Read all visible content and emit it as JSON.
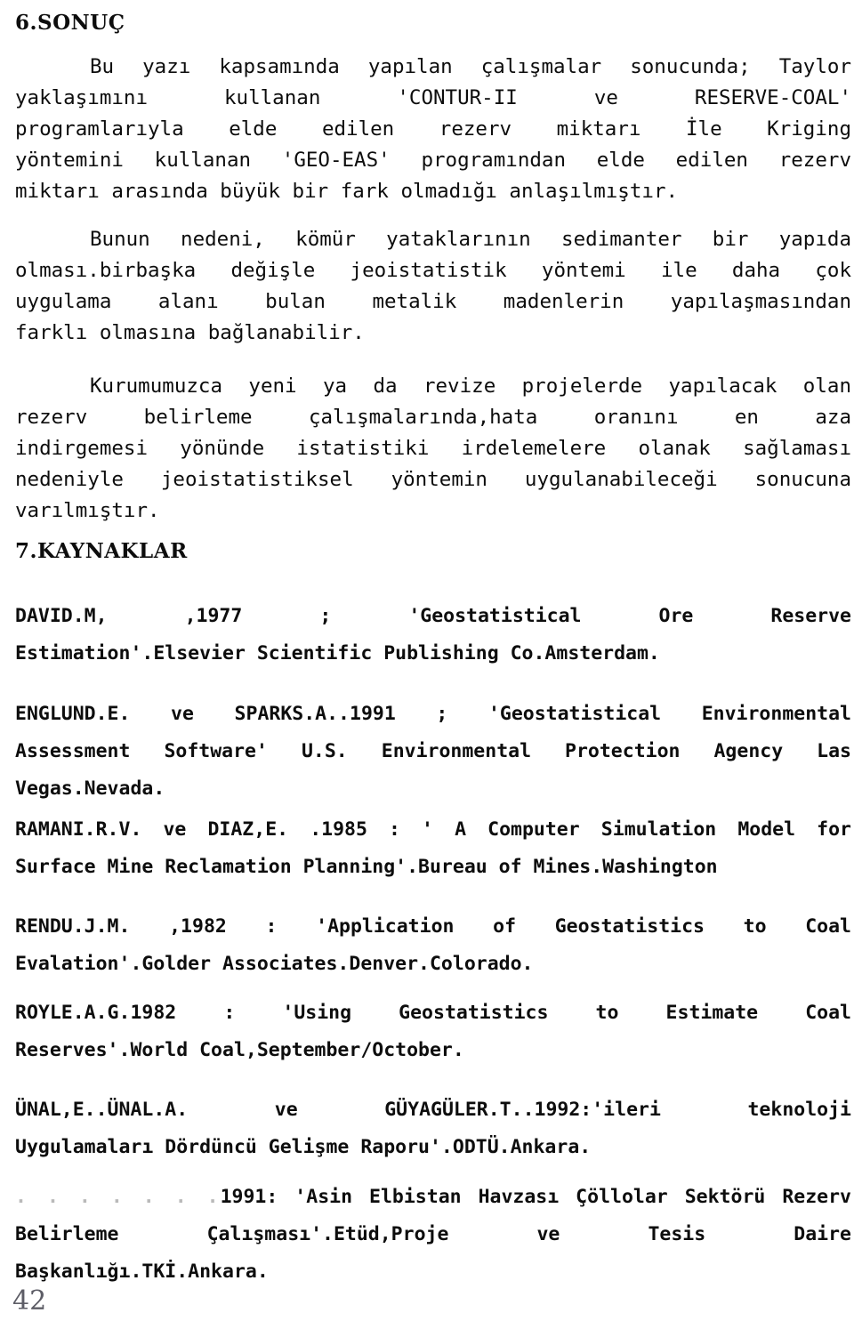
{
  "document": {
    "page_number": "42",
    "language": "tr"
  },
  "sections": {
    "conclusion": {
      "heading": "6.SONUÇ",
      "paragraphs": [
        {
          "id": "p1",
          "lines": [
            "Bu yazı kapsamında yapılan çalışmalar sonucunda; Taylor",
            "yaklaşımını kullanan 'CONTUR-II ve RESERVE-COAL'",
            "programlarıyla elde edilen rezerv miktarı İle Kriging",
            "yöntemini kullanan 'GEO-EAS' programından elde edilen rezerv",
            "miktarı arasında büyük bir fark olmadığı anlaşılmıştır."
          ]
        },
        {
          "id": "p2",
          "lines": [
            "Bunun nedeni, kömür yataklarının sedimanter bir yapıda",
            "olması.birbaşka değişle jeoistatistik yöntemi ile daha çok",
            "uygulama alanı bulan metalik madenlerin yapılaşmasından",
            "farklı olmasına bağlanabilir."
          ]
        },
        {
          "id": "p3",
          "lines": [
            "Kurumumuzca yeni ya da revize projelerde yapılacak olan",
            "rezerv belirleme çalışmalarında,hata oranını en aza",
            "indirgemesi yönünde istatistiki irdelemelere olanak sağlaması",
            "nedeniyle jeoistatistiksel yöntemin uygulanabileceği sonucuna",
            "varılmıştır."
          ]
        }
      ]
    },
    "references": {
      "heading": "7.KAYNAKLAR",
      "entries": [
        {
          "id": "ref-david-1977",
          "lines": [
            "DAVID.M, ,1977 ; 'Geostatistical Ore Reserve",
            "Estimation'.Elsevier Scientific Publishing Co.Amsterdam."
          ]
        },
        {
          "id": "ref-englund-sparks-1991",
          "lines": [
            "ENGLUND.E. ve SPARKS.A..1991 ; 'Geostatistical Environmental",
            "Assessment Software' U.S. Environmental Protection Agency Las",
            "Vegas.Nevada."
          ]
        },
        {
          "id": "ref-ramani-diaz-1985",
          "lines": [
            "RAMANI.R.V. ve DIAZ,E. .1985 : ' A Computer Simulation Model for",
            "Surface Mine Reclamation Planning'.Bureau of Mines.Washington"
          ]
        },
        {
          "id": "ref-rendu-1982",
          "lines": [
            "RENDU.J.M. ,1982 : 'Application of Geostatistics to Coal",
            "Evalation'.Golder Associates.Denver.Colorado."
          ]
        },
        {
          "id": "ref-royle-1982",
          "lines": [
            "ROYLE.A.G.1982 : 'Using Geostatistics to Estimate Coal",
            "Reserves'.World Coal,September/October."
          ]
        },
        {
          "id": "ref-unal-guyaguler-1992",
          "lines": [
            "ÜNAL,E..ÜNAL.A. ve GÜYAGÜLER.T..1992:'ileri teknoloji",
            "Uygulamaları Dördüncü Gelişme Raporu'.ODTÜ.Ankara."
          ]
        },
        {
          "id": "ref-anon-1991",
          "leader": ". . . . . . .",
          "lines": [
            "1991: 'Asin Elbistan Havzası Çöllolar Sektörü Rezerv",
            "Belirleme Çalışması'.Etüd,Proje ve Tesis Daire",
            "Başkanlığı.TKİ.Ankara."
          ]
        }
      ]
    }
  }
}
